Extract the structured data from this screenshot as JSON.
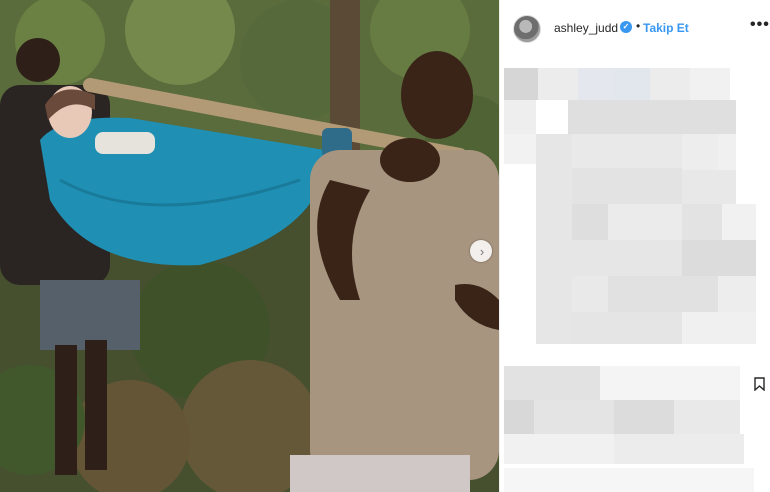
{
  "post": {
    "username": "ashley_judd",
    "verified_mark": "✓",
    "separator": "•",
    "follow_label": "Takip Et",
    "more_label": "•••",
    "carousel_next_label": "›"
  },
  "icons": {
    "avatar": "avatar-icon",
    "verified": "verified-badge-icon",
    "more": "more-options-icon",
    "carousel_next": "chevron-right-icon",
    "bookmark": "bookmark-icon"
  },
  "colors": {
    "accent": "#3897f0",
    "hammock": "#1f8fb3",
    "text": "#262626"
  }
}
